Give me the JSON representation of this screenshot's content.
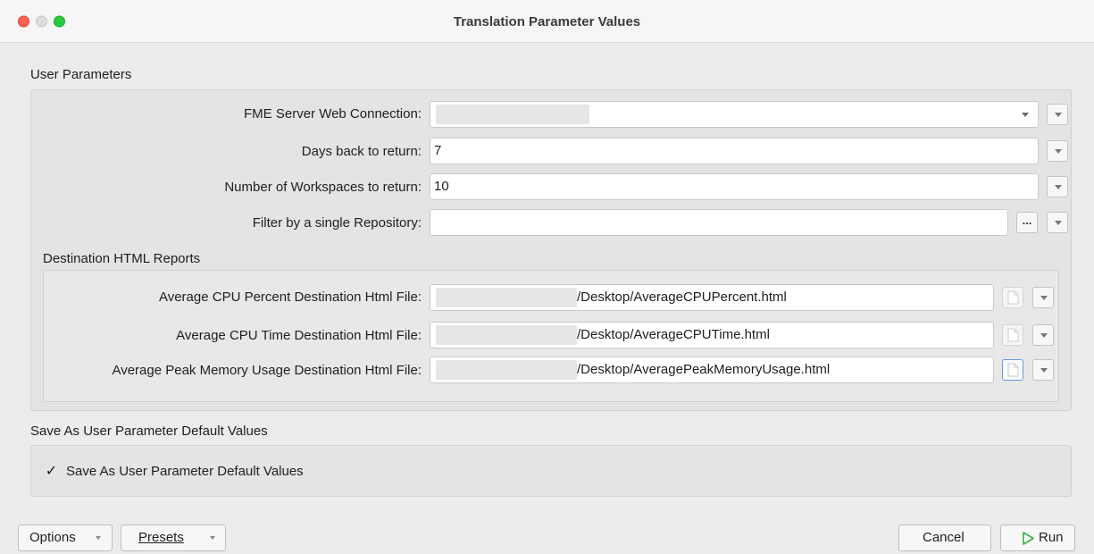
{
  "window": {
    "title": "Translation Parameter Values"
  },
  "user_parameters": {
    "section_label": "User Parameters",
    "fme_connection": {
      "label": "FME Server Web Connection:",
      "value": ""
    },
    "days_back": {
      "label": "Days back to return:",
      "value": "7"
    },
    "num_workspaces": {
      "label": "Number of Workspaces to return:",
      "value": "10"
    },
    "repository": {
      "label": "Filter by a single Repository:",
      "value": ""
    },
    "ellipsis_label": "...",
    "destination": {
      "section_label": "Destination HTML Reports",
      "cpu_percent": {
        "label": "Average CPU Percent Destination Html File:",
        "value": "/Desktop/AverageCPUPercent.html"
      },
      "cpu_time": {
        "label": "Average CPU Time Destination Html File:",
        "value": "/Desktop/AverageCPUTime.html"
      },
      "peak_memory": {
        "label": "Average Peak Memory Usage Destination Html File:",
        "value": "/Desktop/AveragePeakMemoryUsage.html"
      }
    }
  },
  "save_defaults": {
    "section_label": "Save As User Parameter Default Values",
    "checkbox_label": "Save As User Parameter Default Values",
    "checked": true,
    "check_mark": "✓"
  },
  "footer": {
    "options_label": "Options",
    "presets_label": "Presets",
    "cancel_label": "Cancel",
    "run_label": "Run"
  },
  "colors": {
    "close": "#ff5f57",
    "minimize": "#dcdcdc",
    "zoom": "#28c840",
    "run_icon": "#3cb043",
    "focus_ring": "#6a9bd8"
  }
}
